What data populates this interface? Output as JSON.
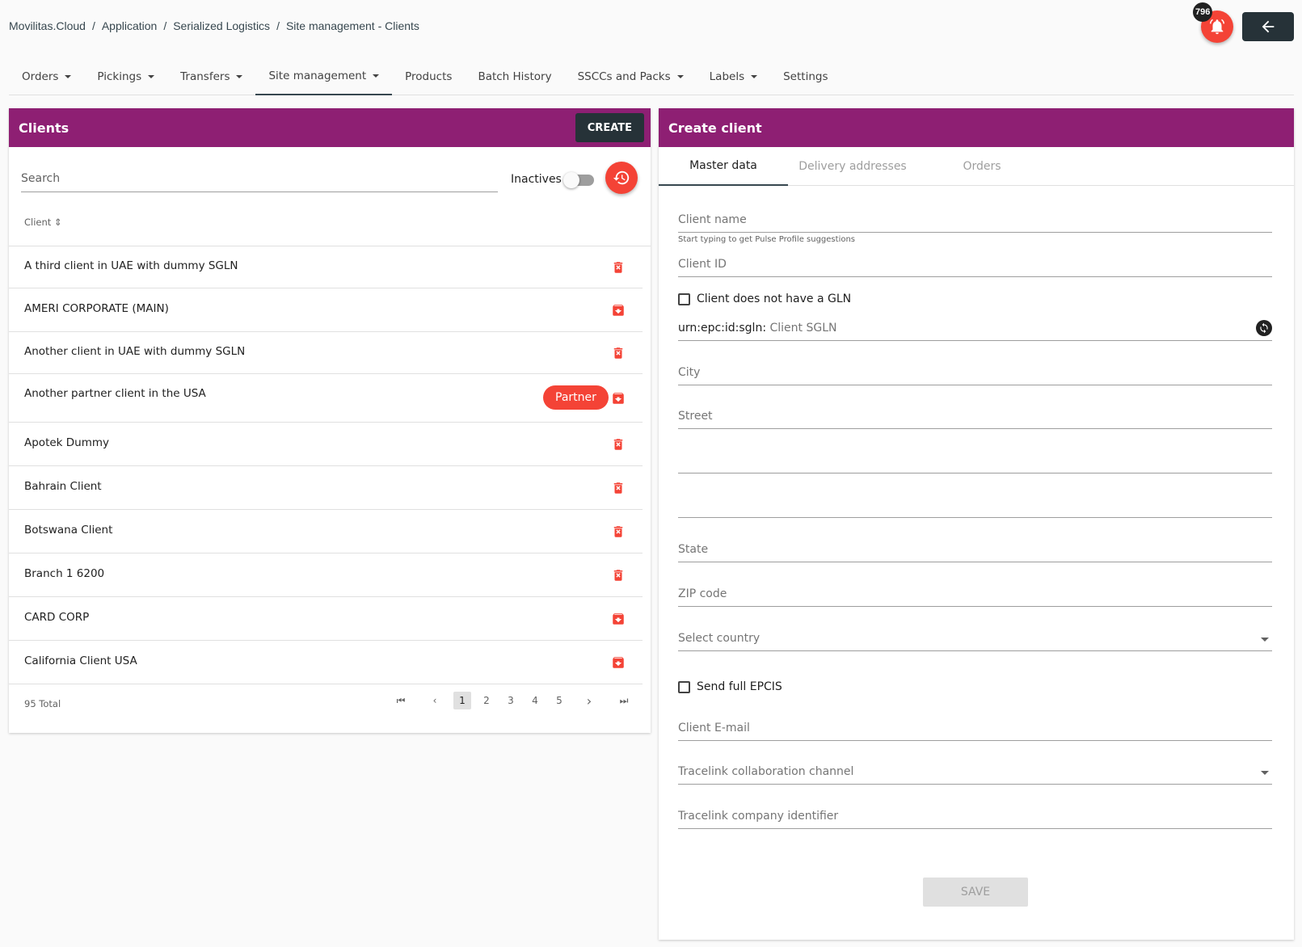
{
  "breadcrumb": [
    "Movilitas.Cloud",
    "Application",
    "Serialized Logistics",
    "Site management - Clients"
  ],
  "notifications": {
    "count": "796"
  },
  "nav": {
    "items": [
      {
        "label": "Orders",
        "dropdown": true
      },
      {
        "label": "Pickings",
        "dropdown": true
      },
      {
        "label": "Transfers",
        "dropdown": true
      },
      {
        "label": "Site management",
        "dropdown": true,
        "active": true
      },
      {
        "label": "Products",
        "dropdown": false
      },
      {
        "label": "Batch History",
        "dropdown": false
      },
      {
        "label": "SSCCs and Packs",
        "dropdown": true
      },
      {
        "label": "Labels",
        "dropdown": true
      },
      {
        "label": "Settings",
        "dropdown": false
      }
    ]
  },
  "clients_panel": {
    "title": "Clients",
    "create_label": "CREATE",
    "search_placeholder": "Search",
    "inactives_label": "Inactives",
    "column_header": "Client",
    "rows": [
      {
        "name": "A third client in UAE with dummy SGLN",
        "action": "delete"
      },
      {
        "name": "AMERI CORPORATE (MAIN)",
        "action": "archive"
      },
      {
        "name": "Another client in UAE with dummy SGLN",
        "action": "delete"
      },
      {
        "name": "Another partner client in the USA",
        "action": "archive",
        "badge": "Partner"
      },
      {
        "name": "Apotek Dummy",
        "action": "delete"
      },
      {
        "name": "Bahrain Client",
        "action": "delete"
      },
      {
        "name": "Botswana Client",
        "action": "delete"
      },
      {
        "name": "Branch 1 6200",
        "action": "delete"
      },
      {
        "name": "CARD CORP",
        "action": "archive"
      },
      {
        "name": "California Client USA",
        "action": "archive"
      }
    ],
    "total_label": "95 Total",
    "pages": [
      "1",
      "2",
      "3",
      "4",
      "5"
    ],
    "current_page": "1"
  },
  "create_panel": {
    "title": "Create client",
    "tabs": [
      "Master data",
      "Delivery addresses",
      "Orders"
    ],
    "client_name": "Client name",
    "client_name_hint": "Start typing to get Pulse Profile suggestions",
    "client_id": "Client ID",
    "no_gln_label": "Client does not have a GLN",
    "sgln_prefix": "urn:epc:id:sgln:",
    "sgln_placeholder": "Client SGLN",
    "city": "City",
    "street": "Street",
    "state": "State",
    "zip": "ZIP code",
    "country": "Select country",
    "send_epcis_label": "Send full EPCIS",
    "email": "Client E-mail",
    "tracelink_channel": "Tracelink collaboration channel",
    "tracelink_company": "Tracelink company identifier",
    "save_label": "SAVE"
  },
  "colors": {
    "header": "#8e1f73",
    "accent": "#f44336",
    "dark": "#263238"
  }
}
